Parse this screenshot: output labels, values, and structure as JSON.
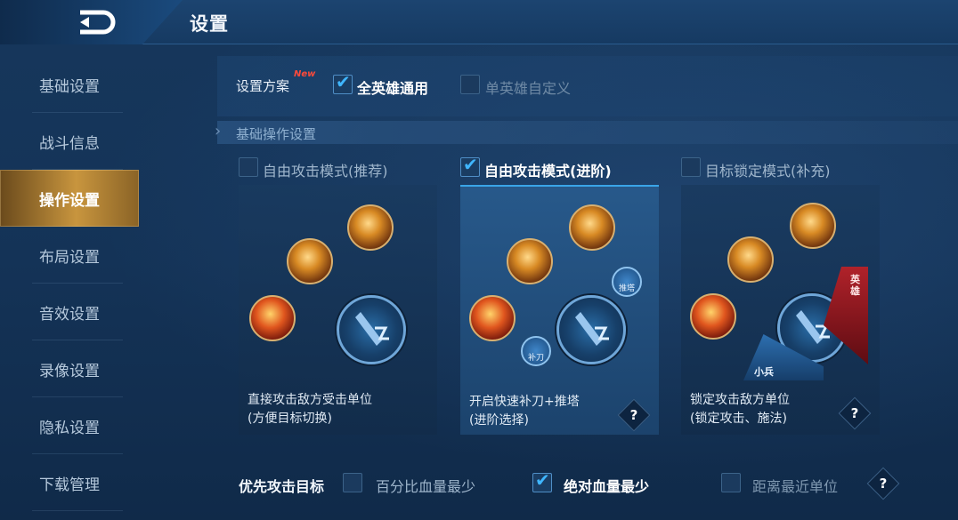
{
  "header": {
    "title": "设置",
    "back_icon": "back-arrow-icon"
  },
  "sidebar": {
    "items": [
      {
        "label": "基础设置"
      },
      {
        "label": "战斗信息"
      },
      {
        "label": "操作设置"
      },
      {
        "label": "布局设置"
      },
      {
        "label": "音效设置"
      },
      {
        "label": "录像设置"
      },
      {
        "label": "隐私设置"
      },
      {
        "label": "下载管理"
      }
    ],
    "active_index": 2
  },
  "scheme": {
    "label": "设置方案",
    "badge": "New",
    "options": [
      {
        "label": "全英雄通用",
        "checked": true
      },
      {
        "label": "单英雄自定义",
        "checked": false
      }
    ]
  },
  "section": {
    "title": "基础操作设置"
  },
  "modes": [
    {
      "label": "自由攻击模式(推荐)",
      "checked": false,
      "desc1": "直接攻击敌方受击单位",
      "desc2": "(方便目标切换)"
    },
    {
      "label": "自由攻击模式(进阶)",
      "checked": true,
      "desc1": "开启快速补刀+推塔",
      "desc2": "(进阶选择)",
      "help": "?",
      "mini_tower": "推塔",
      "mini_last_hit": "补刀"
    },
    {
      "label": "目标锁定模式(补充)",
      "checked": false,
      "desc1": "锁定攻击敌方单位",
      "desc2": "(锁定攻击、施法)",
      "help": "?",
      "lock_hero": "英雄",
      "lock_minion": "小兵"
    }
  ],
  "priority": {
    "label": "优先攻击目标",
    "options": [
      {
        "label": "百分比血量最少",
        "checked": false
      },
      {
        "label": "绝对血量最少",
        "checked": true
      },
      {
        "label": "距离最近单位",
        "checked": false
      }
    ],
    "help": "?"
  },
  "colors": {
    "accent_blue": "#3fb6ff",
    "active_gold": "#c8953e",
    "new_red": "#ff4a3a"
  }
}
